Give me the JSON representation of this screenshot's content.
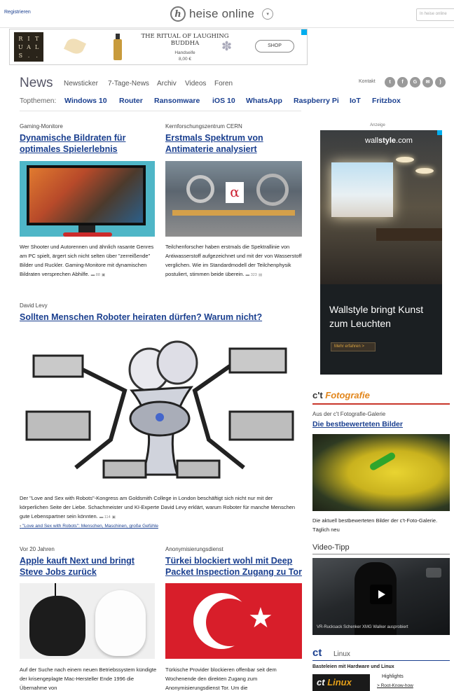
{
  "header": {
    "register_label": "Registrieren",
    "logo_text": "heise online",
    "search_placeholder": "In heise online"
  },
  "ad_banner": {
    "logo_letters": [
      "R",
      "I",
      "T",
      "U",
      "A",
      "L",
      "S",
      ".",
      "."
    ],
    "title": "THE RITUAL OF LAUGHING BUDDHA",
    "product": "Handseife",
    "price": "8,00 €",
    "cta": "SHOP"
  },
  "nav": {
    "section_title": "News",
    "links": [
      "Newsticker",
      "7-Tage-News",
      "Archiv",
      "Videos",
      "Foren"
    ],
    "contact_label": "Kontakt",
    "social_icons": [
      "twitter-icon",
      "facebook-icon",
      "googleplus-icon",
      "mail-icon",
      "rss-icon"
    ],
    "topics_label": "Topthemen:",
    "topics": [
      "Windows 10",
      "Router",
      "Ransomware",
      "iOS 10",
      "WhatsApp",
      "Raspberry Pi",
      "IoT",
      "Fritzbox"
    ]
  },
  "articles": [
    {
      "kicker": "Gaming-Monitore",
      "headline": "Dynamische Bildraten für optimales Spielerlebnis",
      "teaser": "Wer Shooter und Autorennen und ähnlich rasante Genres am PC spielt, ärgert sich nicht selten über \"zerreißende\" Bilder und Ruckler. Gaming-Monitore mit dynamischen Bildraten versprechen Abhilfe.",
      "comments": "88"
    },
    {
      "kicker": "Kernforschungszentrum CERN",
      "headline": "Erstmals Spektrum von Antimaterie analysiert",
      "teaser": "Teilchenforscher haben erstmals die Spektrallinie von Antiwasserstoff aufgezeichnet und mit der von Wasserstoff verglichen. Wie im Standardmodell der Teilchenphysik postuliert, stimmen beide überein.",
      "comments": "323"
    },
    {
      "kicker": "David Levy",
      "headline": "Sollten Menschen Roboter heiraten dürfen? Warum nicht?",
      "teaser": "Der \"Love and Sex with Robots\"-Kongress am Goldsmith College in London beschäftigt sich nicht nur mit der körperlichen Seite der Liebe. Schachmeister und KI-Experte David Levy erklärt, warum Roboter für manche Menschen gute Lebenspartner sein könnten.",
      "comments": "114",
      "related_link": "\"Love and Sex with Robots\": Menschen, Maschinen, große Gefühle"
    },
    {
      "kicker": "Vor 20 Jahren",
      "headline": "Apple kauft Next und bringt Steve Jobs zurück",
      "teaser": "Auf der Suche nach einem neuen Betriebssystem kündigte der krisengeplagte Mac-Hersteller Ende 1996 die Übernahme von"
    },
    {
      "kicker": "Anonymisierungsdienst",
      "headline": "Türkei blockiert wohl mit Deep Packet Inspection Zugang zu Tor",
      "teaser": "Türkische Provider blockieren offenbar seit dem Wochenende den direkten Zugang zum Anonymisierungsdienst Tor. Um die"
    }
  ],
  "sidebar": {
    "ad_label": "Anzeige",
    "ad_brand_light": "wall",
    "ad_brand_bold": "style",
    "ad_brand_tld": ".com",
    "ad_text": "Wallstyle bringt Kunst zum Leuchten",
    "ad_cta": "Mehr erfahren >",
    "ct_foto": {
      "brand": "c't",
      "title": "Fotografie",
      "kicker": "Aus der c't Fotografie-Galerie",
      "headline": "Die bestbewerteten Bilder",
      "text": "Die aktuell bestbewerteten Bilder der c't-Foto-Galerie. Täglich neu"
    },
    "video": {
      "label": "Video-Tipp",
      "caption": "VR-Rucksack Schenker XMG Walker ausprobiert"
    },
    "ct_linux": {
      "brand": "ct",
      "label": "Linux",
      "desc": "Basteleien mit Hardware und Linux",
      "badge_ct": "ct",
      "badge_linux": "Linux",
      "highlights": "Highlights",
      "link": "> Root-Know-how"
    }
  },
  "colors": {
    "link_blue": "#1a3f8f",
    "ct_orange": "#e2861b",
    "ct_red_line": "#c8362a"
  }
}
